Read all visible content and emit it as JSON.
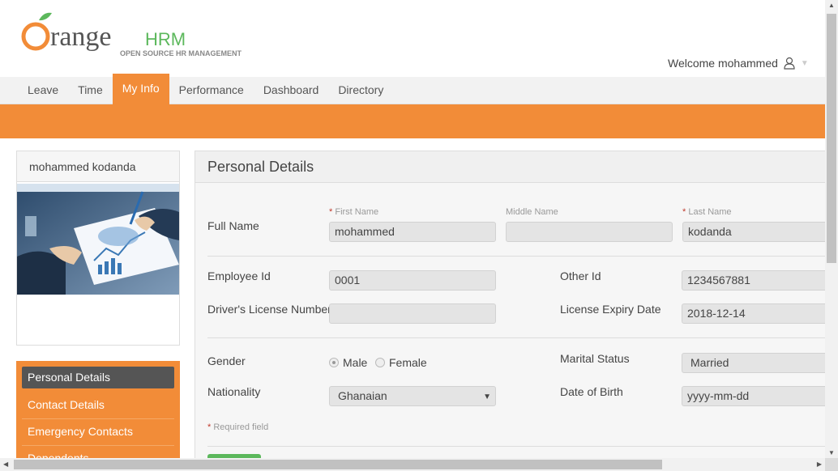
{
  "brand": {
    "logo_main": "range",
    "logo_hrm": "HRM",
    "tagline": "OPEN SOURCE HR MANAGEMENT",
    "orange": "#f28c38",
    "green": "#5cb85c"
  },
  "header": {
    "welcome": "Welcome mohammed",
    "user_icon": "user-icon"
  },
  "nav": {
    "items": [
      "Leave",
      "Time",
      "My Info",
      "Performance",
      "Dashboard",
      "Directory"
    ],
    "active": "My Info"
  },
  "profile": {
    "name": "mohammed kodanda",
    "photo": "business-meeting-photo"
  },
  "side_menu": {
    "items": [
      "Personal Details",
      "Contact Details",
      "Emergency Contacts",
      "Dependents"
    ],
    "active": "Personal Details"
  },
  "personal_details": {
    "title": "Personal Details",
    "full_name_label": "Full Name",
    "first_name_label": "First Name",
    "first_name": "mohammed",
    "middle_name_label": "Middle Name",
    "middle_name": "",
    "last_name_label": "Last Name",
    "last_name": "kodanda",
    "employee_id_label": "Employee Id",
    "employee_id": "0001",
    "other_id_label": "Other Id",
    "other_id": "1234567881",
    "license_label": "Driver's License Number",
    "license": "",
    "license_expiry_label": "License Expiry Date",
    "license_expiry": "2018-12-14",
    "gender_label": "Gender",
    "gender_options": [
      "Male",
      "Female"
    ],
    "gender_selected": "Male",
    "marital_label": "Marital Status",
    "marital_status": "Married",
    "nationality_label": "Nationality",
    "nationality": "Ghanaian",
    "dob_label": "Date of Birth",
    "dob_placeholder": "yyyy-mm-dd",
    "required_marker": "*",
    "required_note": "Required field"
  }
}
